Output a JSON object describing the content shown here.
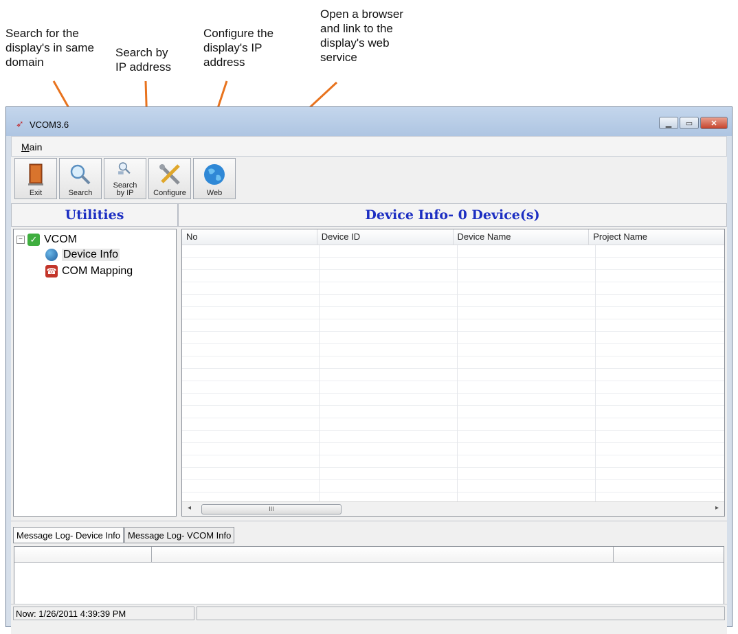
{
  "callouts": {
    "search": "Search for the\ndisplay's in same\ndomain",
    "search_ip": "Search by\nIP address",
    "configure": "Configure the\ndisplay's IP\naddress",
    "web": "Open a browser\nand link to the\ndisplay's web\nservice"
  },
  "window": {
    "title": "VCOM3.6",
    "min_icon": "minimize-icon",
    "max_icon": "maximize-icon",
    "close_icon": "close-icon"
  },
  "menu": {
    "main": "Main"
  },
  "toolbar": {
    "exit": "Exit",
    "search": "Search",
    "search_ip": "Search\nby IP",
    "configure": "Configure",
    "web": "Web"
  },
  "utilities": {
    "title": "Utilities",
    "root": "VCOM",
    "items": [
      "Device Info",
      "COM Mapping"
    ]
  },
  "device_info": {
    "title": "Device Info- 0 Device(s)",
    "columns": [
      "No",
      "Device ID",
      "Device Name",
      "Project Name"
    ],
    "rows": [],
    "scroll_thumb": "III"
  },
  "log": {
    "tabs": [
      "Message Log- Device Info",
      "Message Log- VCOM Info"
    ]
  },
  "status": {
    "now": "Now: 1/26/2011 4:39:39 PM"
  },
  "colors": {
    "accent_title": "#1c2ec2",
    "callout_arrow": "#e8731e"
  }
}
